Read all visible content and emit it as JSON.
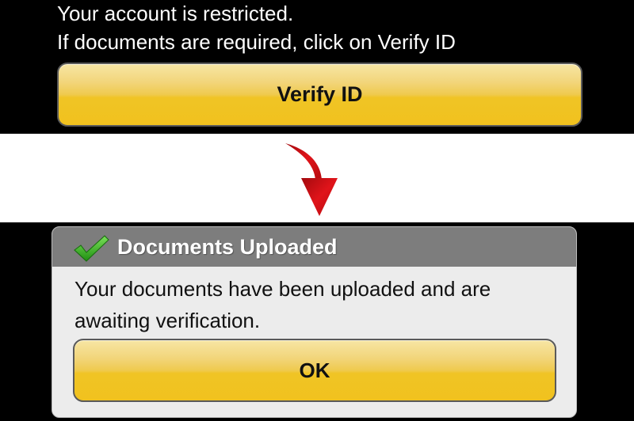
{
  "account_notice": {
    "line1": "Your account is restricted.",
    "line2": "If documents are required, click on Verify ID",
    "verify_button_label": "Verify ID"
  },
  "transition": {
    "arrow_icon": "curved-down-arrow-icon",
    "arrow_color": "#d40d12"
  },
  "dialog": {
    "title": "Documents Uploaded",
    "title_icon": "green-checkmark-icon",
    "message": "Your documents have been uploaded and are awaiting verification.",
    "ok_button_label": "OK"
  },
  "colors": {
    "button_gold": "#f0c425",
    "dialog_header": "#7d7d7d",
    "dialog_body": "#ececec",
    "check_green": "#2fae1b"
  }
}
